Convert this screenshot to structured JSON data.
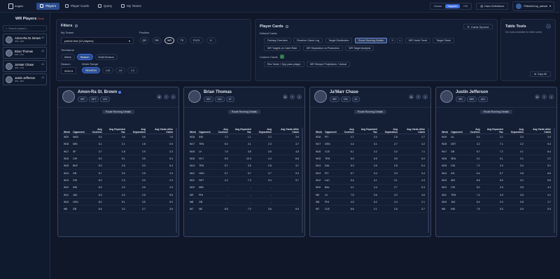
{
  "app": {
    "logo_text": "Angles"
  },
  "nav": [
    {
      "label": "Players",
      "active": true
    },
    {
      "label": "Player Cards",
      "active": false
    },
    {
      "label": "Query",
      "active": false
    },
    {
      "label": "My Teams",
      "active": false
    }
  ],
  "theme": {
    "options": [
      "Classic",
      "Sapphire",
      "Y2K"
    ],
    "selected": "Sapphire"
  },
  "data_definitions": "Data Definitions",
  "user": "PMcMcCoy_admin",
  "sidebar": {
    "title": "WR Players",
    "clear": "Clear",
    "search_placeholder": "Search players...",
    "players": [
      {
        "name": "Amon-Ra St. Brown",
        "sub": "WR • DET",
        "rank": "#1"
      },
      {
        "name": "Brian Thomas",
        "sub": "WR • JAX",
        "rank": "#1"
      },
      {
        "name": "Ja'Marr Chase",
        "sub": "WR • CIN",
        "rank": "#1"
      },
      {
        "name": "Justin Jefferson",
        "sub": "WR • MIN",
        "rank": "#1"
      }
    ]
  },
  "filters": {
    "title": "Filters",
    "my_teams_label": "My Teams",
    "my_teams_value": "patrick test (12 players)",
    "position_label": "Position",
    "positions": [
      "QB",
      "RB",
      "WR",
      "TE",
      "FLEX",
      "K"
    ],
    "position_selected": "WR",
    "timeframe_label": "Timeframe",
    "timeframes": [
      "Week",
      "Season",
      "Multi-Season"
    ],
    "timeframe_selected": "Season",
    "season_label": "Season",
    "season_value": "2024",
    "week_range_label": "Week Range",
    "week_ranges": [
      "SEASON",
      "L10",
      "L5",
      "L3"
    ],
    "week_range_selected": "SEASON"
  },
  "player_cards": {
    "title": "Player Cards",
    "synced": "Cards Synced",
    "default_label": "Default Cards",
    "defaults": [
      "Fantasy Overview",
      "Receiver Game Log",
      "Target Distribution",
      "Route Running Details",
      "WR Yards Trend",
      "Target Share",
      "WR Targets vs Catch Rate",
      "WR Separation vs Production",
      "WR Target Analysis"
    ],
    "default_selected": "Route Running Details",
    "custom_label": "Custom Cards",
    "custom": [
      "Rec Yards + Opp pass ydsgm",
      "WR Sleeper Projections + Actual"
    ]
  },
  "table_tools": {
    "title": "Table Tools",
    "empty": "No tools available for table cards",
    "copy_all": "Copy All"
  },
  "columns": [
    "Week",
    "Opponent",
    "Avg Cushion",
    "Avg Expected Yac",
    "Avg Separation",
    "Avg Yards After Catch"
  ],
  "tab_label": "Route Running Details",
  "cards": [
    {
      "name": "Amon-Ra St. Brown",
      "pos": "WR",
      "team": "DET",
      "rank": "#14",
      "rows": [
        [
          "W20",
          "WAS",
          "5.4",
          "4.6",
          "3.6",
          "7.6"
        ],
        [
          "W18",
          "MIN",
          "6.1",
          "2.1",
          "1.8",
          "0.5"
        ],
        [
          "W17",
          "SF",
          "4.7",
          "1.8",
          "2.9",
          "2.3"
        ],
        [
          "W16",
          "CHI",
          "6.0",
          "5.1",
          "3.5",
          "5.4"
        ],
        [
          "W15",
          "BUF",
          "5.0",
          "2.6",
          "3.0",
          "5.4"
        ],
        [
          "W14",
          "GB",
          "6.7",
          "3.0",
          "2.5",
          "4.3"
        ],
        [
          "W13",
          "CHI",
          "5.0",
          "2.3",
          "3.0",
          "2.3"
        ],
        [
          "W12",
          "IND",
          "6.0",
          "4.3",
          "3.6",
          "2.9"
        ],
        [
          "W11",
          "JAX",
          "6.9",
          "4.0",
          "2.6",
          "5.5"
        ],
        [
          "W10",
          "HOU",
          "8.0",
          "5.1",
          "3.5",
          "5.0"
        ],
        [
          "W8",
          "GB",
          "6.4",
          "3.2",
          "2.7",
          "3.9"
        ]
      ]
    },
    {
      "name": "Brian Thomas",
      "pos": "WR",
      "team": "JAX",
      "rank": "#7",
      "rows": [
        [
          "W18",
          "IND",
          "7.2",
          "1.1",
          "2.2",
          "3.9"
        ],
        [
          "W17",
          "TEN",
          "5.0",
          "4.1",
          "2.3",
          "4.7"
        ],
        [
          "W16",
          "LV",
          "7.5",
          "3.8",
          "3.5",
          "4.5"
        ],
        [
          "W15",
          "NYJ",
          "5.9",
          "10.3",
          "4.4",
          "8.6"
        ],
        [
          "W14",
          "TEN",
          "5.7",
          "3.5",
          "2.8",
          "3.7"
        ],
        [
          "W12",
          "HOU",
          "5.7",
          "5.7",
          "3.7",
          "9.3"
        ],
        [
          "W11",
          "DET",
          "4.2",
          "7.3",
          "3.4",
          "9.7"
        ],
        [
          "W10",
          "MIN",
          "-",
          "-",
          "-",
          "-"
        ],
        [
          "W9",
          "PHI",
          "-",
          "-",
          "-",
          "-"
        ],
        [
          "W8",
          "GB",
          "-",
          "-",
          "-",
          "-"
        ],
        [
          "W7",
          "NE",
          "6.5",
          "7.0",
          "3.6",
          "5.9"
        ]
      ]
    },
    {
      "name": "Ja'Marr Chase",
      "pos": "WR",
      "team": "CIN",
      "rank": "#1",
      "rows": [
        [
          "W18",
          "PIT",
          "4.7",
          "2.4",
          "2.8",
          "2.7"
        ],
        [
          "W17",
          "DEN",
          "4.4",
          "3.1",
          "2.7",
          "4.2"
        ],
        [
          "W16",
          "CLE",
          "5.1",
          "2.2",
          "3.2",
          "7.1"
        ],
        [
          "W15",
          "TEN",
          "6.0",
          "6.5",
          "3.5",
          "6.0"
        ],
        [
          "W14",
          "DAL",
          "5.3",
          "3.6",
          "2.8",
          "5.4"
        ],
        [
          "W13",
          "PIT",
          "5.7",
          "3.4",
          "3.0",
          "3.4"
        ],
        [
          "W12",
          "LAC",
          "5.4",
          "4.1",
          "3.1",
          "4.3"
        ],
        [
          "W10",
          "BAL",
          "4.1",
          "4.4",
          "2.7",
          "5.3"
        ],
        [
          "W9",
          "LV",
          "7.5",
          "3.6",
          "3.2",
          "4.6"
        ],
        [
          "W8",
          "PHI",
          "4.9",
          "5.2",
          "2.4",
          "2.1"
        ],
        [
          "W7",
          "CLE",
          "6.6",
          "2.1",
          "2.6",
          "3.7"
        ]
      ]
    },
    {
      "name": "Justin Jefferson",
      "pos": "WR",
      "team": "MIN",
      "rank": "#18",
      "rows": [
        [
          "W19",
          "LA",
          "5.4",
          "2.1",
          "3.2",
          "3.9"
        ],
        [
          "W18",
          "DET",
          "4.2",
          "7.1",
          "2.2",
          "5.4"
        ],
        [
          "W17",
          "GB",
          "5.7",
          "7.2",
          "4.1",
          "8.4"
        ],
        [
          "W16",
          "SEA",
          "4.1",
          "3.1",
          "2.1",
          "2.2"
        ],
        [
          "W15",
          "CHI",
          "7.2",
          "2.9",
          "3.4",
          "5.1"
        ],
        [
          "W14",
          "ATL",
          "6.4",
          "5.7",
          "3.8",
          "6.6"
        ],
        [
          "W13",
          "ARI",
          "6.6",
          "6.0",
          "3.2",
          "5.6"
        ],
        [
          "W12",
          "CHI",
          "5.0",
          "2.6",
          "3.5",
          "4.4"
        ],
        [
          "W11",
          "TEN",
          "7.4",
          "4.9",
          "3.5",
          "4.1"
        ],
        [
          "W10",
          "JAX",
          "6.4",
          "2.0",
          "3.8",
          "2.7"
        ],
        [
          "W9",
          "IND",
          "7.5",
          "3.3",
          "3.0",
          "5.4"
        ]
      ]
    }
  ]
}
